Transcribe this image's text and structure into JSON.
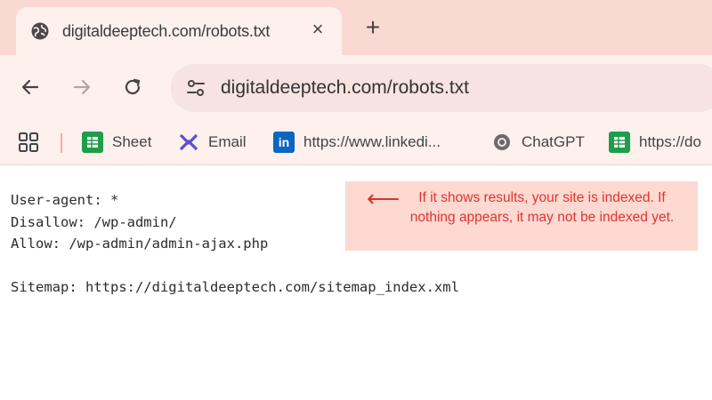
{
  "browser": {
    "tab": {
      "title": "digitaldeeptech.com/robots.txt",
      "favicon": "globe-icon",
      "close": "×"
    },
    "new_tab": "+",
    "toolbar": {
      "url": "digitaldeeptech.com/robots.txt",
      "back_icon": "back-arrow-icon",
      "forward_icon": "forward-arrow-icon",
      "reload_icon": "reload-icon",
      "site_info_icon": "tune-icon"
    },
    "bookmarks": [
      {
        "label": "Sheet",
        "icon": "sheets-icon",
        "color": "#1e9e4a"
      },
      {
        "label": "Email",
        "icon": "email-icon",
        "color": "#5a4fd6"
      },
      {
        "label": "https://www.linkedi...",
        "icon": "linkedin-icon",
        "color": "#0a66c2"
      },
      {
        "label": "ChatGPT",
        "icon": "chatgpt-icon",
        "color": "#6b6b6b"
      },
      {
        "label": "https://do",
        "icon": "sheets-icon",
        "color": "#1e9e4a"
      }
    ]
  },
  "page": {
    "robots_lines": [
      "User-agent: *",
      "Disallow: /wp-admin/",
      "Allow: /wp-admin/admin-ajax.php",
      "",
      "Sitemap: https://digitaldeeptech.com/sitemap_index.xml"
    ],
    "callout": {
      "arrow": "⟵",
      "text": "If it shows results, your site is indexed. If nothing appears, it may not be indexed yet."
    }
  },
  "colors": {
    "tabstrip_bg": "#fbd9d3",
    "toolbar_bg": "#fdf0ed",
    "callout_bg": "#fdd9d2",
    "callout_text": "#e0352d"
  }
}
